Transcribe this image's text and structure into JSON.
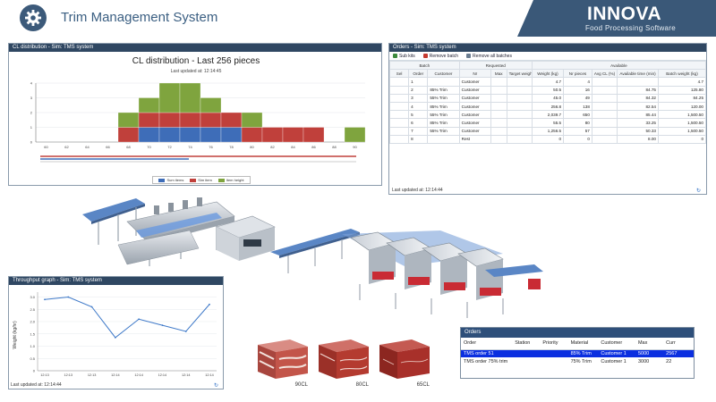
{
  "header": {
    "title": "Trim Management System",
    "brand": "INNOVA",
    "brand_sub": "Food Processing Software"
  },
  "cl_panel": {
    "panel_title": "CL distribution - Sim: TMS system",
    "chart_title": "CL distribution - Last 256 pieces",
    "updated": "Last updated at: 12:14:45",
    "legend": [
      "Sum items",
      "Sim item",
      "Item height"
    ],
    "colors": {
      "blue": "#3e6db8",
      "red": "#c0403b",
      "green": "#7fa43e"
    },
    "x_ticks": [
      "60",
      "62",
      "64",
      "66",
      "68",
      "70",
      "72",
      "74",
      "76",
      "78",
      "80",
      "82",
      "84",
      "86",
      "88",
      "90"
    ],
    "y_ticks": [
      "0",
      "1",
      "2",
      "3",
      "4"
    ]
  },
  "chart_data": {
    "type": "bar",
    "title": "CL distribution - Last 256 pieces",
    "categories": [
      "60",
      "62",
      "64",
      "66",
      "68",
      "70",
      "72",
      "74",
      "76",
      "78",
      "80",
      "82",
      "84",
      "86",
      "88",
      "90"
    ],
    "series": [
      {
        "name": "Sum items",
        "values": [
          0,
          0,
          0,
          0,
          0,
          1,
          1,
          1,
          1,
          1,
          0,
          0,
          0,
          0,
          0,
          0
        ]
      },
      {
        "name": "Sim item",
        "values": [
          0,
          0,
          0,
          0,
          1,
          1,
          1,
          1,
          1,
          1,
          1,
          1,
          1,
          1,
          0,
          0
        ]
      },
      {
        "name": "Item height",
        "values": [
          0,
          0,
          0,
          0,
          1,
          1,
          2,
          2,
          1,
          0,
          1,
          0,
          0,
          0,
          0,
          1
        ]
      }
    ],
    "ylim": [
      0,
      4
    ]
  },
  "orders_panel": {
    "panel_title": "Orders - Sim: TMS system",
    "toolbar": [
      "Sub kits",
      "Remove batch",
      "Remove all batches"
    ],
    "group_headers": [
      "Batch",
      "Requested",
      "Available"
    ],
    "columns": [
      "Sel",
      "Order",
      "Customer",
      "Nr",
      "Max",
      "Target weight (kg)",
      "Weight (kg)",
      "Nr pieces",
      "Avg CL (%)",
      "Available time (min)",
      "Batch weight (kg)"
    ],
    "rows": [
      [
        "",
        "1",
        "",
        "Customer",
        "",
        "",
        "4.7",
        "4",
        "",
        "",
        "4.7"
      ],
      [
        "",
        "2",
        "85% Trim",
        "Customer",
        "",
        "",
        "50.5",
        "16",
        "",
        "84.75",
        "125.80"
      ],
      [
        "",
        "3",
        "55% Trim",
        "Customer",
        "",
        "",
        "45.0",
        "49",
        "",
        "84.32",
        "84.25"
      ],
      [
        "",
        "4",
        "85% Trim",
        "Customer",
        "",
        "",
        "256.8",
        "138",
        "",
        "82.54",
        "120.00"
      ],
      [
        "",
        "5",
        "55% Trim",
        "Customer",
        "",
        "",
        "2,039.7",
        "650",
        "",
        "85.44",
        "1,500.50"
      ],
      [
        "",
        "6",
        "85% Trim",
        "Customer",
        "",
        "",
        "55.5",
        "80",
        "",
        "33.25",
        "1,500.50"
      ],
      [
        "",
        "7",
        "55% Trim",
        "Customer",
        "",
        "",
        "1,256.5",
        "57",
        "",
        "50.33",
        "1,500.50"
      ],
      [
        "",
        "8",
        "",
        "Rest",
        "",
        "",
        "0",
        "0",
        "",
        "8.00",
        "0"
      ]
    ],
    "status": "Last updated at: 12:14:44"
  },
  "throughput_panel": {
    "panel_title": "Throughput graph - Sim: TMS system",
    "ylabel": "Weight (kg/hr)",
    "status": "Last updated at: 12:14:44"
  },
  "tp_chart": {
    "x": [
      "12:13",
      "12:13",
      "12:13",
      "12:14",
      "12:14",
      "12:14",
      "12:14",
      "12:14"
    ],
    "y": [
      2.9,
      3.0,
      2.6,
      1.35,
      2.1,
      1.85,
      1.6,
      2.7
    ],
    "yticks": [
      "0",
      "0.5",
      "1.0",
      "1.5",
      "2.0",
      "2.5",
      "3.0"
    ],
    "ylim": [
      0,
      3.2
    ]
  },
  "orders_small": {
    "title": "Orders",
    "columns": [
      "Order",
      "Station",
      "Priority",
      "Material",
      "Customer",
      "Max",
      "Curr"
    ],
    "rows": [
      [
        "TMS order 51",
        "",
        "",
        "85% Trim",
        "Customer 1",
        "5000",
        "2567"
      ],
      [
        "TMS order 75% trim",
        "",
        "",
        "75% Trim",
        "Customer 1",
        "3000",
        "22"
      ]
    ]
  },
  "meat_blocks": [
    "90CL",
    "80CL",
    "65CL"
  ]
}
